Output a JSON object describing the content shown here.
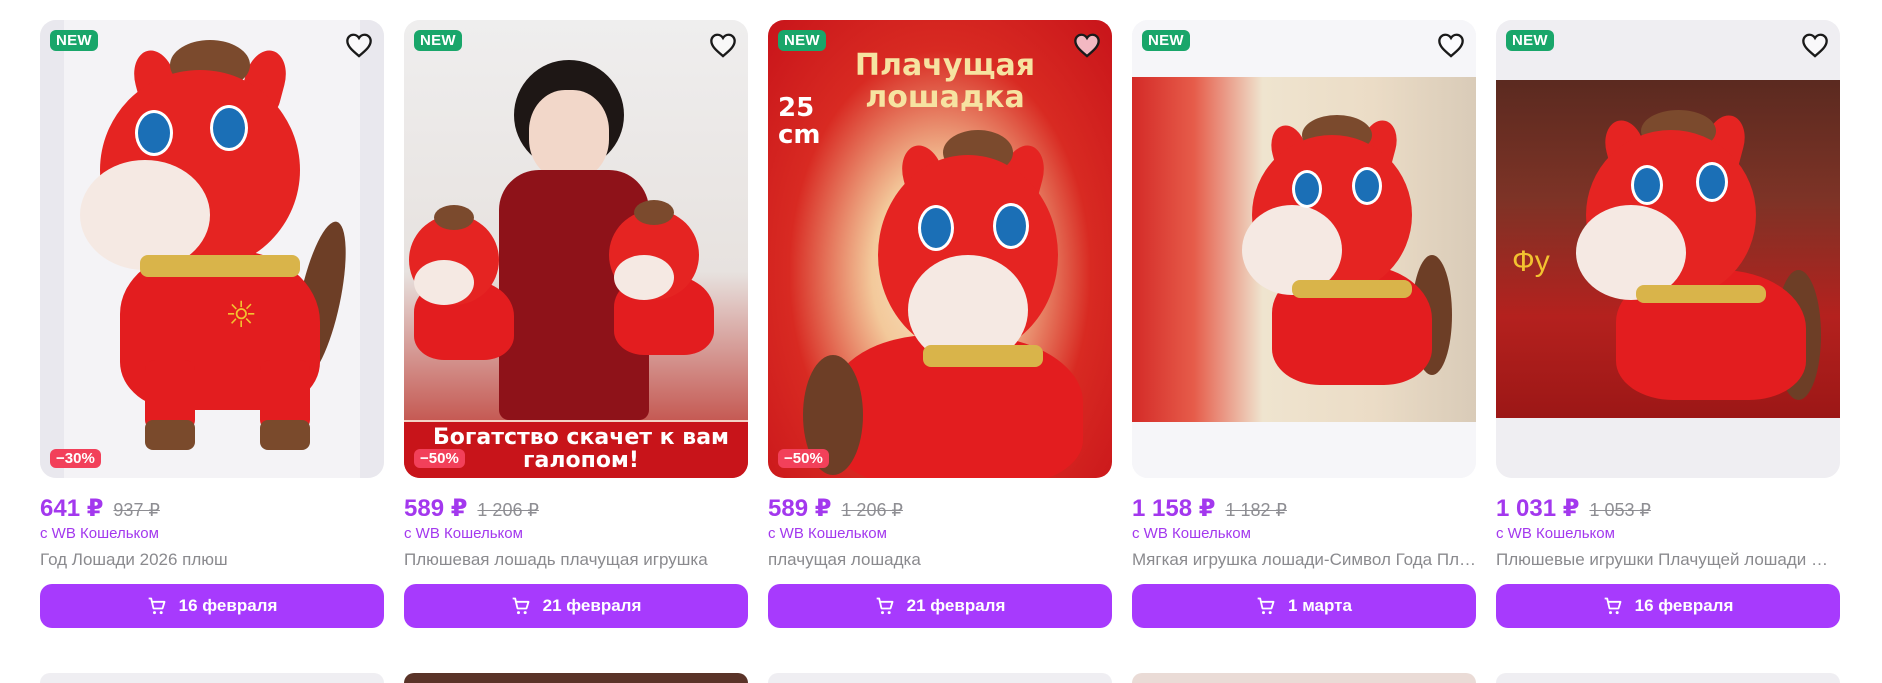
{
  "products": [
    {
      "badge_new": "NEW",
      "discount": "−30%",
      "price": "641 ₽",
      "old_price": "937 ₽",
      "wallet_label": "с WB Кошельком",
      "title": "Год Лошади 2026 плюш",
      "delivery": "16 февраля",
      "favorite_icon": "heart-outline-icon",
      "cart_icon": "cart-icon"
    },
    {
      "badge_new": "NEW",
      "discount": "−50%",
      "price": "589 ₽",
      "old_price": "1 206 ₽",
      "wallet_label": "с WB Кошельком",
      "title": "Плюшевая лошадь плачущая игрушка",
      "delivery": "21 февраля",
      "promo_text": "Богатство скачет к вам галопом!",
      "favorite_icon": "heart-outline-icon",
      "cart_icon": "cart-icon"
    },
    {
      "badge_new": "NEW",
      "discount": "−50%",
      "price": "589 ₽",
      "old_price": "1 206 ₽",
      "wallet_label": "с WB Кошельком",
      "title": "плачущая лошадка",
      "delivery": "21 февраля",
      "promo_text": "Плачущая лошадка",
      "size_text": "25 cm",
      "favorite_icon": "heart-filled-icon",
      "cart_icon": "cart-icon"
    },
    {
      "badge_new": "NEW",
      "price": "1 158 ₽",
      "old_price": "1 182 ₽",
      "wallet_label": "с WB Кошельком",
      "title": "Мягкая игрушка лошади-Символ Года Плачущая",
      "delivery": "1 марта",
      "favorite_icon": "heart-outline-icon",
      "cart_icon": "cart-icon"
    },
    {
      "badge_new": "NEW",
      "price": "1 031 ₽",
      "old_price": "1 053 ₽",
      "wallet_label": "с WB Кошельком",
      "title": "Плюшевые игрушки Плачущей лошади Символ года",
      "delivery": "16 февраля",
      "promo_text": "Фу",
      "favorite_icon": "heart-outline-icon",
      "cart_icon": "cart-icon"
    }
  ],
  "colors": {
    "accent": "#a73afd",
    "price": "#a338ee",
    "badge_new": "#19a66a",
    "badge_discount": "#f2405a"
  }
}
